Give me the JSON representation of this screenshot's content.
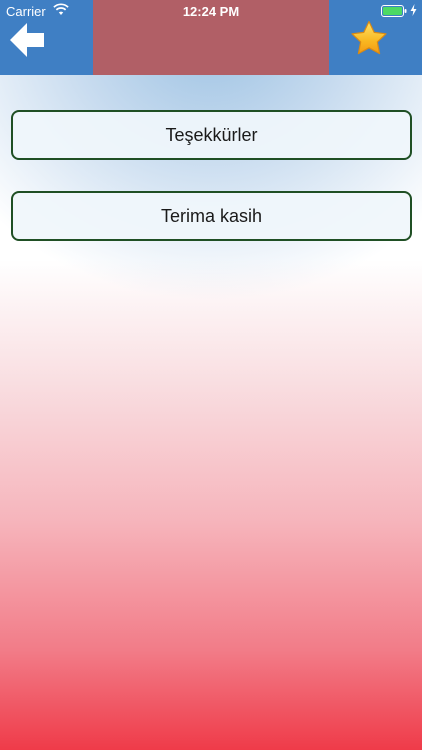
{
  "status_bar": {
    "carrier": "Carrier",
    "time": "12:24 PM",
    "battery_color": "#4cd964"
  },
  "header": {
    "back_icon": "back-arrow-icon",
    "favorite_icon": "star-icon",
    "nav_color": "#3f7fc4",
    "title_color": "#b15f66"
  },
  "translations": [
    {
      "label": "Teşekkürler"
    },
    {
      "label": "Terima kasih"
    }
  ]
}
